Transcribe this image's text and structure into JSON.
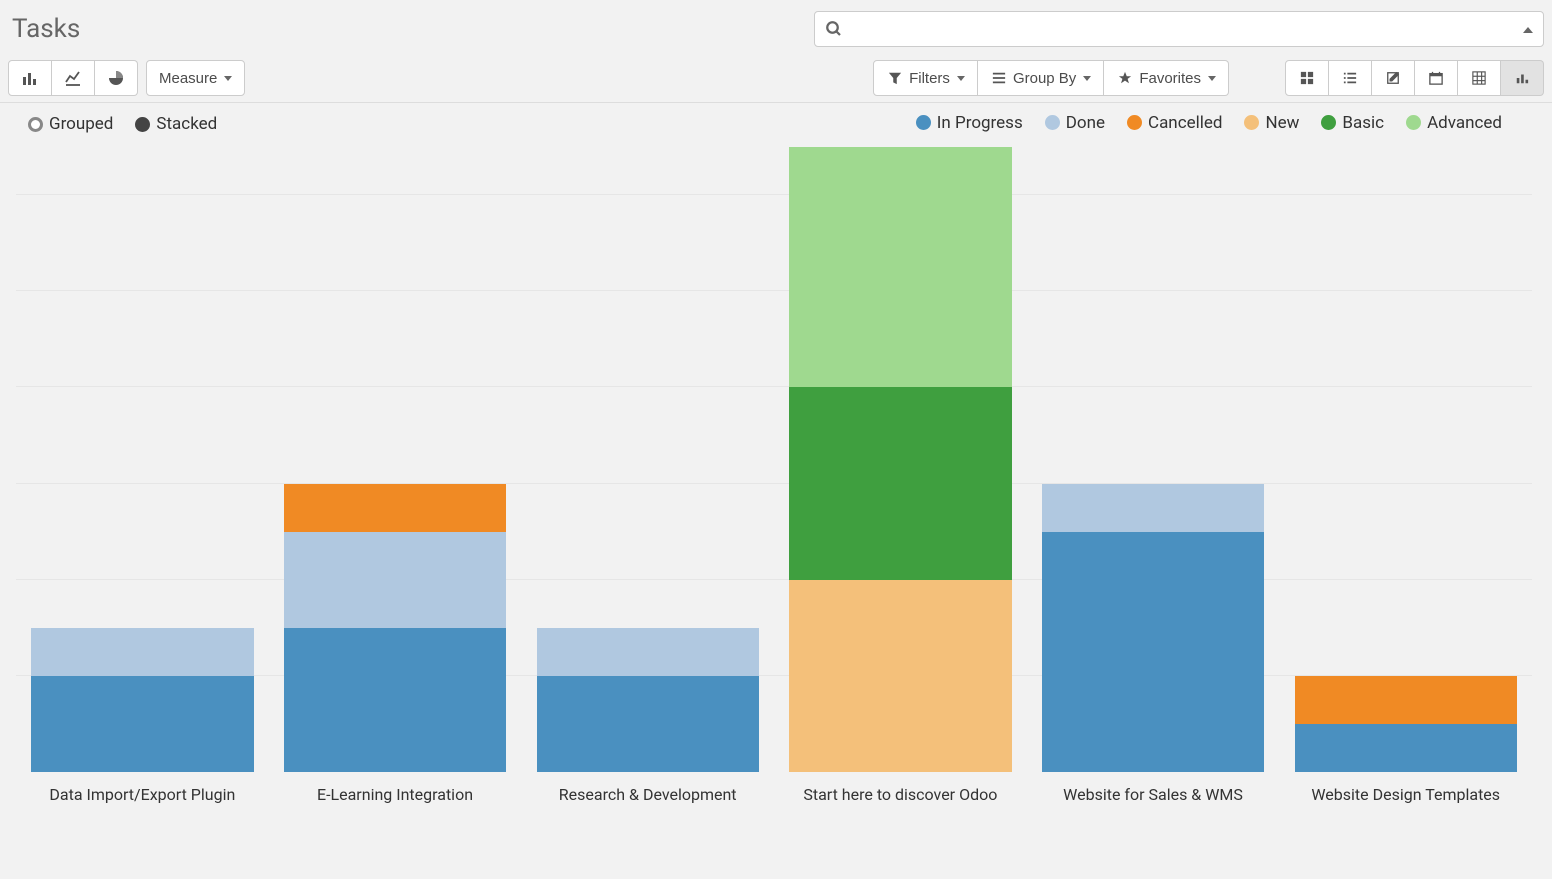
{
  "header": {
    "title": "Tasks"
  },
  "search": {
    "placeholder": ""
  },
  "toolbar": {
    "measure_label": "Measure",
    "filters_label": "Filters",
    "groupby_label": "Group By",
    "favorites_label": "Favorites"
  },
  "stack_toggle": {
    "grouped": "Grouped",
    "stacked": "Stacked",
    "active": "stacked"
  },
  "legend": {
    "items": [
      {
        "name": "In Progress",
        "color": "#4a90c0"
      },
      {
        "name": "Done",
        "color": "#b0c8e0"
      },
      {
        "name": "Cancelled",
        "color": "#f08a24"
      },
      {
        "name": "New",
        "color": "#f4c07a"
      },
      {
        "name": "Basic",
        "color": "#3f9f3f"
      },
      {
        "name": "Advanced",
        "color": "#9fd98f"
      }
    ]
  },
  "chart_data": {
    "type": "bar",
    "stacked": true,
    "categories": [
      "Data Import/Export Plugin",
      "E-Learning Integration",
      "Research & Development",
      "Start here to discover Odoo",
      "Website for Sales & WMS",
      "Website Design Templates"
    ],
    "series": [
      {
        "name": "In Progress",
        "color": "#4a90c0",
        "values": [
          1,
          1.5,
          1,
          0,
          2.5,
          0.5
        ]
      },
      {
        "name": "Done",
        "color": "#b0c8e0",
        "values": [
          0.5,
          1,
          0.5,
          0,
          0.5,
          0
        ]
      },
      {
        "name": "Cancelled",
        "color": "#f08a24",
        "values": [
          0,
          0.5,
          0,
          0,
          0,
          0.5
        ]
      },
      {
        "name": "New",
        "color": "#f4c07a",
        "values": [
          0,
          0,
          0,
          2,
          0,
          0
        ]
      },
      {
        "name": "Basic",
        "color": "#3f9f3f",
        "values": [
          0,
          0,
          0,
          2,
          0,
          0
        ]
      },
      {
        "name": "Advanced",
        "color": "#9fd98f",
        "values": [
          0,
          0,
          0,
          2.5,
          0,
          0
        ]
      }
    ],
    "ylim": [
      0,
      6.5
    ],
    "xlabel": "",
    "ylabel": "",
    "title": ""
  }
}
